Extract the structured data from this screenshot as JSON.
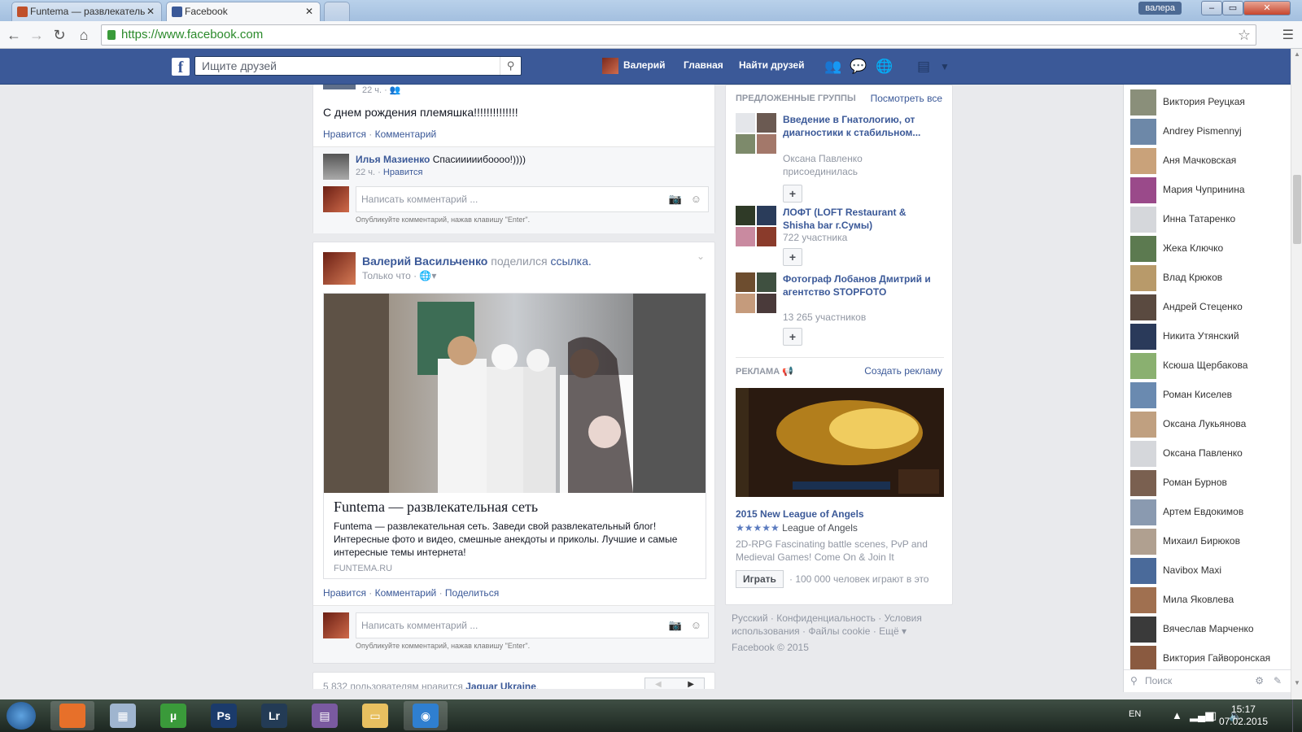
{
  "browser": {
    "tabs": [
      {
        "label": "Funtema — развлекатель"
      },
      {
        "label": "Facebook"
      }
    ],
    "user": "валера",
    "url": "https://www.facebook.com"
  },
  "fb_header": {
    "search_placeholder": "Ищите друзей",
    "user_name": "Валерий",
    "nav_home": "Главная",
    "nav_find_friends": "Найти друзей"
  },
  "post1": {
    "time": "22 ч. ·",
    "text": "С днем рождения племяшка!!!!!!!!!!!!!!",
    "like": "Нравится",
    "sep": "·",
    "comment": "Комментарий",
    "reply": {
      "author": "Илья Мазиенко",
      "text": "Спасииииибоооо!))))",
      "time": "22 ч. ·",
      "like": "Нравится"
    },
    "comment_placeholder": "Написать комментарий ...",
    "comment_hint": "Опубликуйте комментарий, нажав клавишу \"Enter\"."
  },
  "post2": {
    "author": "Валерий Васильченко",
    "shared": "поделился",
    "shared_link": "ссылка.",
    "time": "Только что ·",
    "link_title": "Funtema — развлекательная сеть",
    "link_desc": "Funtema — развлекательная сеть. Заведи свой развлекательный блог! Интересные фото и видео, смешные анекдоты и приколы. Лучшие и самые интересные темы интернета!",
    "link_domain": "FUNTEMA.RU",
    "like": "Нравится",
    "comment": "Комментарий",
    "share": "Поделиться",
    "sep": "·",
    "comment_placeholder": "Написать комментарий ...",
    "comment_hint": "Опубликуйте комментарий, нажав клавишу \"Enter\"."
  },
  "page_like": {
    "count_text": "5 832 пользователям нравится",
    "page": "Jaguar Ukraine",
    "dot": "."
  },
  "suggested_groups": {
    "title": "ПРЕДЛОЖЕННЫЕ ГРУППЫ",
    "see_all": "Посмотреть все",
    "items": [
      {
        "name": "Введение в Гнатологию, от диагностики к стабильном...",
        "meta1": "Оксана Павленко",
        "meta2": "присоединилась"
      },
      {
        "name": "ЛОФТ (LOFT Restaurant & Shisha bar г.Сумы)",
        "meta1": "722 участника"
      },
      {
        "name": "Фотограф Лобанов Дмитрий и агентство STOPFOTO",
        "meta1": "13 265 участников"
      }
    ],
    "join": "+"
  },
  "ads": {
    "title": "РЕКЛАМА",
    "create": "Создать рекламу",
    "ad_title": "2015 New League of Angels",
    "stars": "★★★★★",
    "stars_value": 4.5,
    "publisher": "League of Angels",
    "desc": "2D-RPG Fascinating battle scenes, PvP and Medieval Games! Come On & Join It",
    "play": "Играть",
    "players": "· 100 000 человек играют в это"
  },
  "footer": {
    "links": [
      "Русский",
      "Конфиденциальность",
      "Условия использования",
      "Файлы cookie",
      "Ещё ▾"
    ],
    "sep": " · ",
    "copyright": "Facebook © 2015"
  },
  "chat": {
    "contacts": [
      "Виктория Реуцкая",
      "Andrey Pismennyj",
      "Аня Мачковская",
      "Мария Чупринина",
      "Инна Татаренко",
      "Жека Ключко",
      "Влад Крюков",
      "Андрей Стеценко",
      "Никита Утянский",
      "Ксюша Щербакова",
      "Роман Киселев",
      "Оксана Лукьянова",
      "Оксана Павленко",
      "Роман Бурнов",
      "Артем Евдокимов",
      "Михаил Бирюков",
      "Navibox Maxi",
      "Мила Яковлева",
      "Вячеслав Марченко",
      "Виктория Гайворонская"
    ],
    "search_placeholder": "Поиск"
  },
  "taskbar": {
    "apps": [
      "Firefox",
      "Calculator",
      "uTorrent",
      "Ps",
      "Lr",
      "WinRAR",
      "Explorer",
      "Chrome"
    ],
    "lang": "EN",
    "time": "15:17",
    "date": "07.02.2015"
  },
  "colors": {
    "fb_blue": "#3b5998",
    "link": "#3b5998"
  }
}
